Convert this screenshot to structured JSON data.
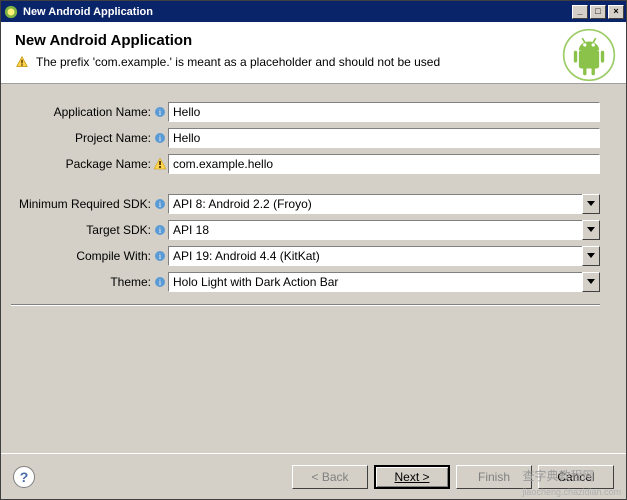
{
  "window": {
    "title": "New Android Application"
  },
  "banner": {
    "heading": "New Android Application",
    "warning": "The prefix 'com.example.' is meant as a placeholder and should not be used"
  },
  "form": {
    "appName": {
      "label": "Application Name:",
      "value": "Hello"
    },
    "projectName": {
      "label": "Project Name:",
      "value": "Hello"
    },
    "packageName": {
      "label": "Package Name:",
      "value": "com.example.hello"
    },
    "minSdk": {
      "label": "Minimum Required SDK:",
      "value": "API 8: Android 2.2 (Froyo)"
    },
    "targetSdk": {
      "label": "Target SDK:",
      "value": "API 18"
    },
    "compileWith": {
      "label": "Compile With:",
      "value": "API 19: Android 4.4 (KitKat)"
    },
    "theme": {
      "label": "Theme:",
      "value": "Holo Light with Dark Action Bar"
    }
  },
  "buttons": {
    "back": "< Back",
    "next": "Next >",
    "finish": "Finish",
    "cancel": "Cancel"
  },
  "watermark": {
    "main": "查字典教程网",
    "sub": "jiaocheng.chazidian.com"
  }
}
